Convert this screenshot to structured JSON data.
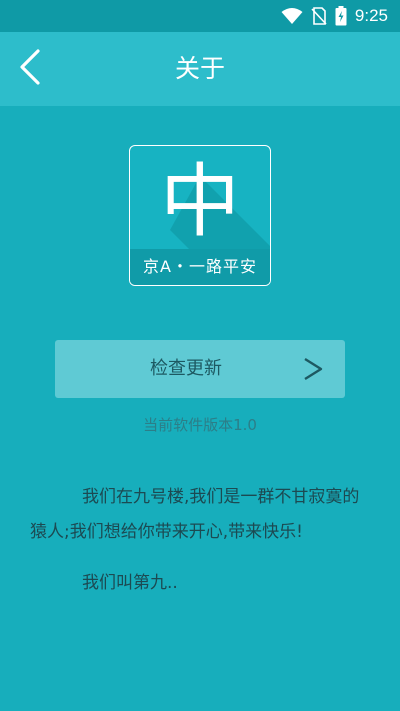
{
  "status_bar": {
    "time": "9:25",
    "icons": [
      "wifi-icon",
      "no-sim-icon",
      "battery-charging-icon"
    ]
  },
  "app_bar": {
    "title": "关于",
    "back_icon": "chevron-left-icon"
  },
  "app_icon": {
    "glyph": "中",
    "caption": "京A・一路平安"
  },
  "update": {
    "label": "检查更新",
    "icon": "chevron-right-icon"
  },
  "version": {
    "text": "当前软件版本1.0"
  },
  "about": {
    "paragraph_1": "我们在九号楼,我们是一群不甘寂寞的猿人;我们想给你带来开心,带来快乐!",
    "paragraph_2": "我们叫第九.."
  },
  "colors": {
    "background": "#17aebc",
    "app_bar": "#2dbdcb",
    "status_bar": "#0f9aa6",
    "button": "#5fcad4",
    "text_dark": "#1c4a52"
  }
}
